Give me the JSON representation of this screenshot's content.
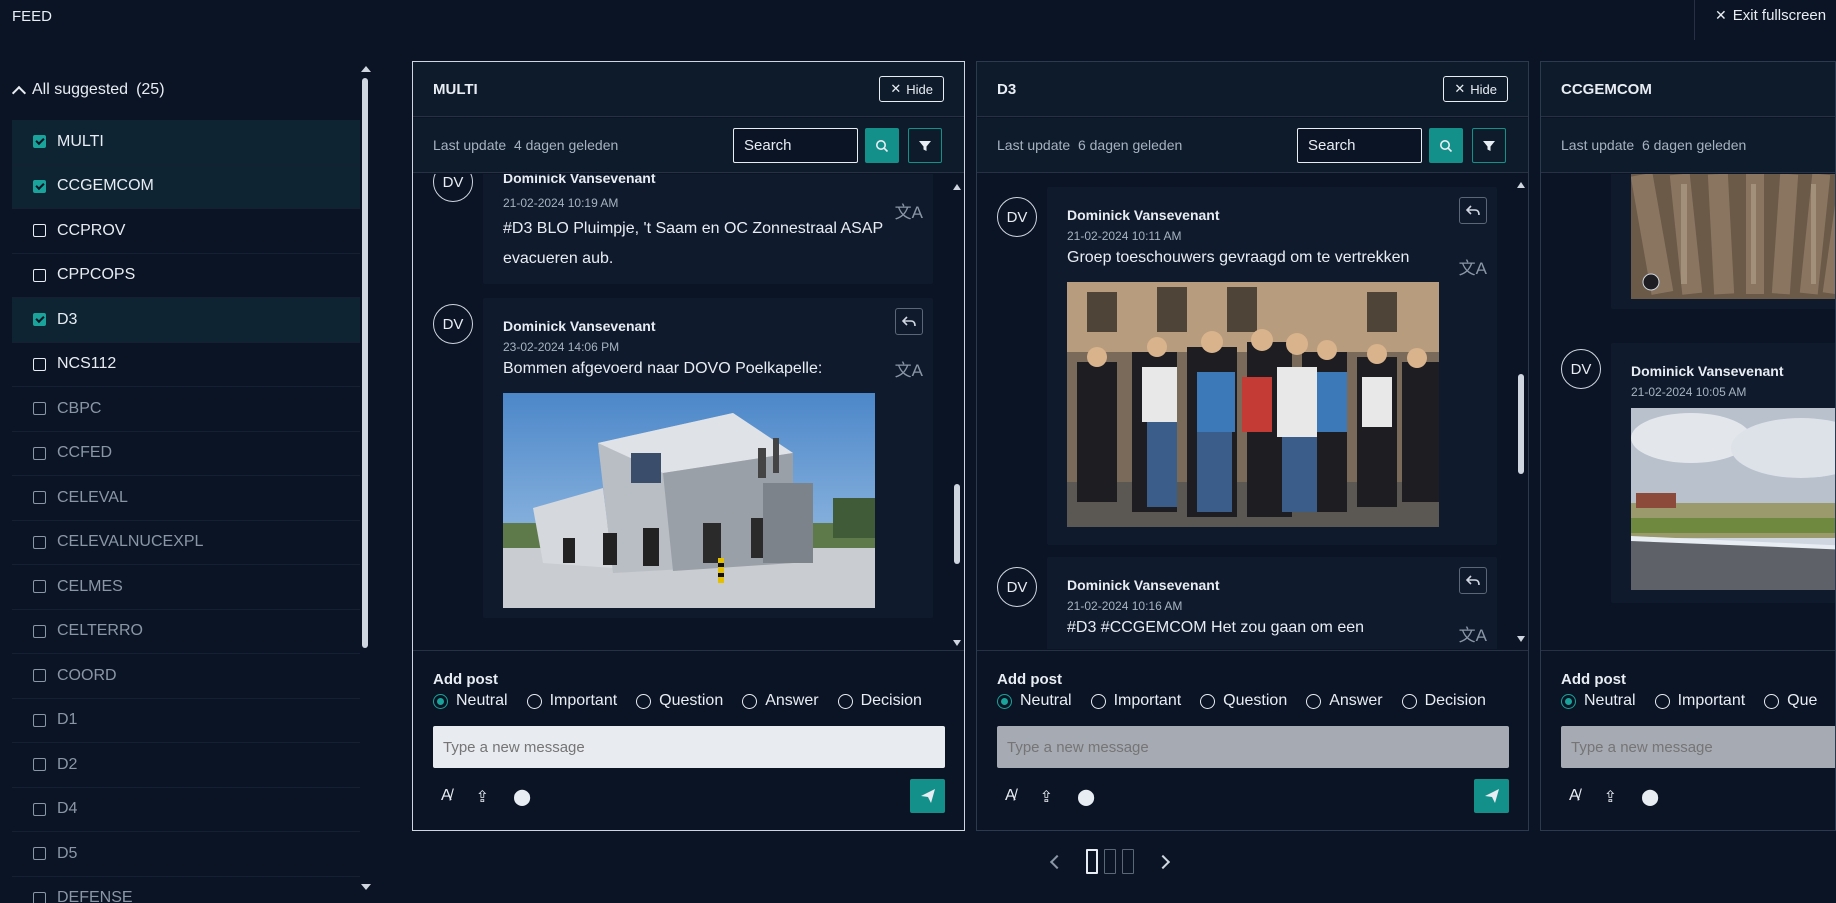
{
  "app": {
    "title": "FEED",
    "exit_label": "Exit fullscreen"
  },
  "sidebar": {
    "header": "All suggested",
    "count": "(25)",
    "items": [
      {
        "label": "MULTI",
        "checked": true,
        "active": true
      },
      {
        "label": "CCGEMCOM",
        "checked": true,
        "active": true
      },
      {
        "label": "CCPROV",
        "checked": false,
        "active": true
      },
      {
        "label": "CPPCOPS",
        "checked": false,
        "active": true
      },
      {
        "label": "D3",
        "checked": true,
        "active": true
      },
      {
        "label": "NCS112",
        "checked": false,
        "active": true
      },
      {
        "label": "CBPC",
        "checked": false,
        "active": false
      },
      {
        "label": "CCFED",
        "checked": false,
        "active": false
      },
      {
        "label": "CELEVAL",
        "checked": false,
        "active": false
      },
      {
        "label": "CELEVALNUCEXPL",
        "checked": false,
        "active": false
      },
      {
        "label": "CELMES",
        "checked": false,
        "active": false
      },
      {
        "label": "CELTERRO",
        "checked": false,
        "active": false
      },
      {
        "label": "COORD",
        "checked": false,
        "active": false
      },
      {
        "label": "D1",
        "checked": false,
        "active": false
      },
      {
        "label": "D2",
        "checked": false,
        "active": false
      },
      {
        "label": "D4",
        "checked": false,
        "active": false
      },
      {
        "label": "D5",
        "checked": false,
        "active": false
      },
      {
        "label": "DEFENSE",
        "checked": false,
        "active": false
      }
    ]
  },
  "columns": [
    {
      "title": "MULTI",
      "hide_label": "Hide",
      "last_update_label": "Last update",
      "last_update_value": "4 dagen geleden",
      "search_placeholder": "Search",
      "posts": [
        {
          "initials": "DV",
          "author": "Dominick Vansevenant",
          "date": "21-02-2024 10:19 AM",
          "text": "#D3 BLO Pluimpje, 't Saam en OC Zonnestraal ASAP evacueren aub."
        },
        {
          "initials": "DV",
          "author": "Dominick Vansevenant",
          "date": "23-02-2024 14:06 PM",
          "text": "Bommen afgevoerd naar DOVO Poelkapelle:"
        }
      ]
    },
    {
      "title": "D3",
      "hide_label": "Hide",
      "last_update_label": "Last update",
      "last_update_value": "6 dagen geleden",
      "search_placeholder": "Search",
      "posts": [
        {
          "initials": "DV",
          "author": "Dominick Vansevenant",
          "date": "21-02-2024 10:11 AM",
          "text": "Groep toeschouwers gevraagd om te vertrekken"
        },
        {
          "initials": "DV",
          "author": "Dominick Vansevenant",
          "date": "21-02-2024 10:16 AM",
          "text": "#D3 #CCGEMCOM Het zou gaan om een"
        }
      ]
    },
    {
      "title": "CCGEMCOM",
      "last_update_label": "Last update",
      "last_update_value": "6 dagen geleden",
      "posts": [
        {
          "initials": "DV",
          "author": "Dominick Vansevenant",
          "date": "21-02-2024 10:05 AM"
        }
      ]
    }
  ],
  "compose": {
    "label": "Add post",
    "options": [
      "Neutral",
      "Important",
      "Question",
      "Answer",
      "Decision"
    ],
    "option_partial": "Que",
    "selected": "Neutral",
    "placeholder": "Type a new message"
  },
  "colors": {
    "accent": "#14908a",
    "background": "#0b1424",
    "panel": "#0f1a2c"
  }
}
